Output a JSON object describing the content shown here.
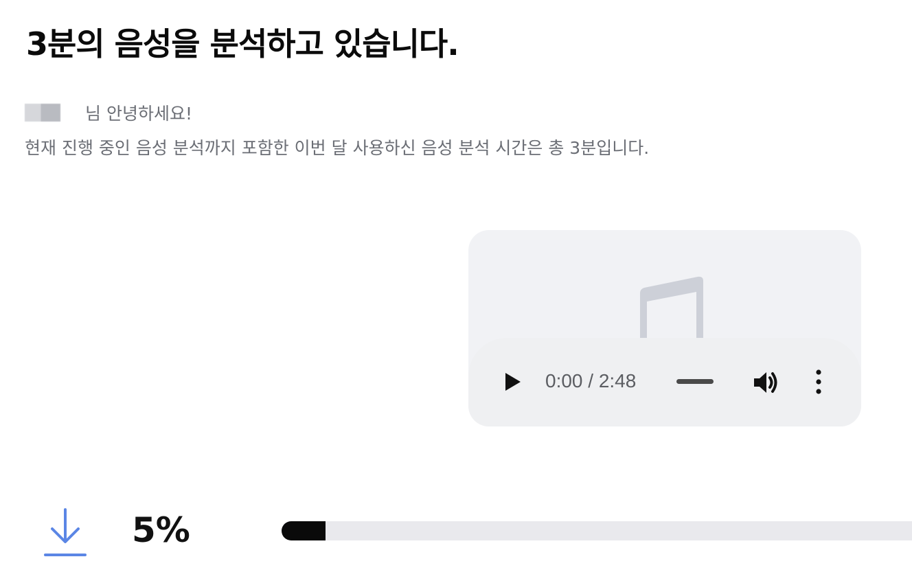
{
  "header": {
    "title": "3분의 음성을 분석하고 있습니다."
  },
  "info": {
    "greeting_suffix": "님 안녕하세요!",
    "usage_message": "현재 진행 중인 음성 분석까지 포함한 이번 달 사용하신 음성 분석 시간은 총 3분입니다."
  },
  "audio_player": {
    "time_display": "0:00 / 2:48",
    "icons": {
      "artwork": "music-note-icon",
      "play": "play-icon",
      "volume": "volume-icon",
      "more": "more-vertical-icon"
    }
  },
  "progress": {
    "percent_label": "5%",
    "value": 0.07,
    "download_icon": "download-icon"
  },
  "colors": {
    "accent": "#5b86e5",
    "progress_fill": "#0a0a0a",
    "progress_track": "#e9e9ed",
    "card_background": "#f1f2f5",
    "muted_text": "#6b6e75"
  }
}
